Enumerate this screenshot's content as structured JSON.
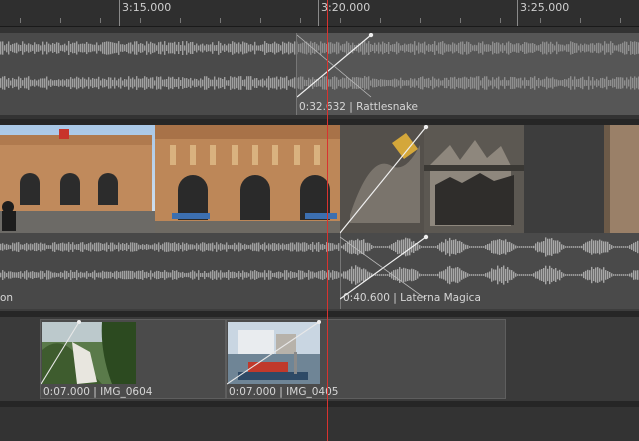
{
  "ruler": {
    "labels": [
      "3:15.000",
      "3:20.000",
      "3:25.000"
    ]
  },
  "tracks": {
    "audio_top": {
      "clip_label": "0:32.632 | Rattlesnake"
    },
    "video_main": {
      "audio_clip_label": "0:40.600 | Laterna Magica",
      "left_clip_label_tail": "on"
    },
    "photos": {
      "clips": [
        {
          "label": "0:07.000 | IMG_0604"
        },
        {
          "label": "0:07.000 | IMG_0405"
        }
      ]
    }
  },
  "colors": {
    "playhead": "#d8332f",
    "track_bg": "#3a3a3a",
    "clip_bg": "#4a4a4a",
    "waveform": "#9a9a9a"
  }
}
